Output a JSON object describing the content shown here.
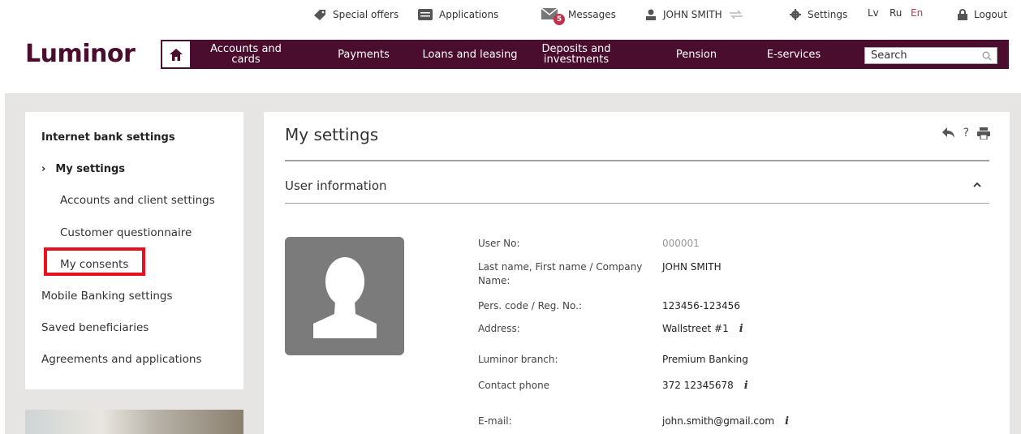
{
  "topbar": {
    "special_offers": "Special offers",
    "applications": "Applications",
    "messages": "Messages",
    "messages_count": "5",
    "user_name": "JOHN SMITH",
    "settings": "Settings",
    "lang_lv": "Lv",
    "lang_ru": "Ru",
    "lang_en": "En",
    "logout": "Logout"
  },
  "header": {
    "logo": "Luminor"
  },
  "nav": {
    "items": [
      {
        "label": "Accounts and cards"
      },
      {
        "label": "Payments"
      },
      {
        "label": "Loans and leasing"
      },
      {
        "label": "Deposits and investments"
      },
      {
        "label": "Pension"
      },
      {
        "label": "E-services"
      }
    ],
    "search_placeholder": "Search"
  },
  "sidebar": {
    "title": "Internet bank settings",
    "active_item": "My settings",
    "sub_items": [
      {
        "label": "Accounts and client settings"
      },
      {
        "label": "Customer questionnaire"
      },
      {
        "label": "My consents"
      }
    ],
    "items": [
      {
        "label": "Mobile Banking settings"
      },
      {
        "label": "Saved beneficiaries"
      },
      {
        "label": "Agreements and applications"
      }
    ]
  },
  "main": {
    "title": "My settings",
    "section_title": "User information",
    "fields": [
      {
        "label": "User No:",
        "value": "000001"
      },
      {
        "label": "Last name, First name / Company Name:",
        "value": "JOHN SMITH"
      },
      {
        "label": "Pers. code / Reg. No.:",
        "value": "123456-123456"
      },
      {
        "label": "Address:",
        "value": "Wallstreet #1"
      },
      {
        "label": "Luminor branch:",
        "value": "Premium Banking"
      },
      {
        "label": "Contact phone",
        "value": "372 12345678"
      },
      {
        "label": "E-mail:",
        "value": "john.smith@gmail.com"
      }
    ]
  },
  "colors": {
    "brand": "#4a0d2e",
    "accent_red": "#c4314b",
    "highlight": "#e8101e"
  }
}
